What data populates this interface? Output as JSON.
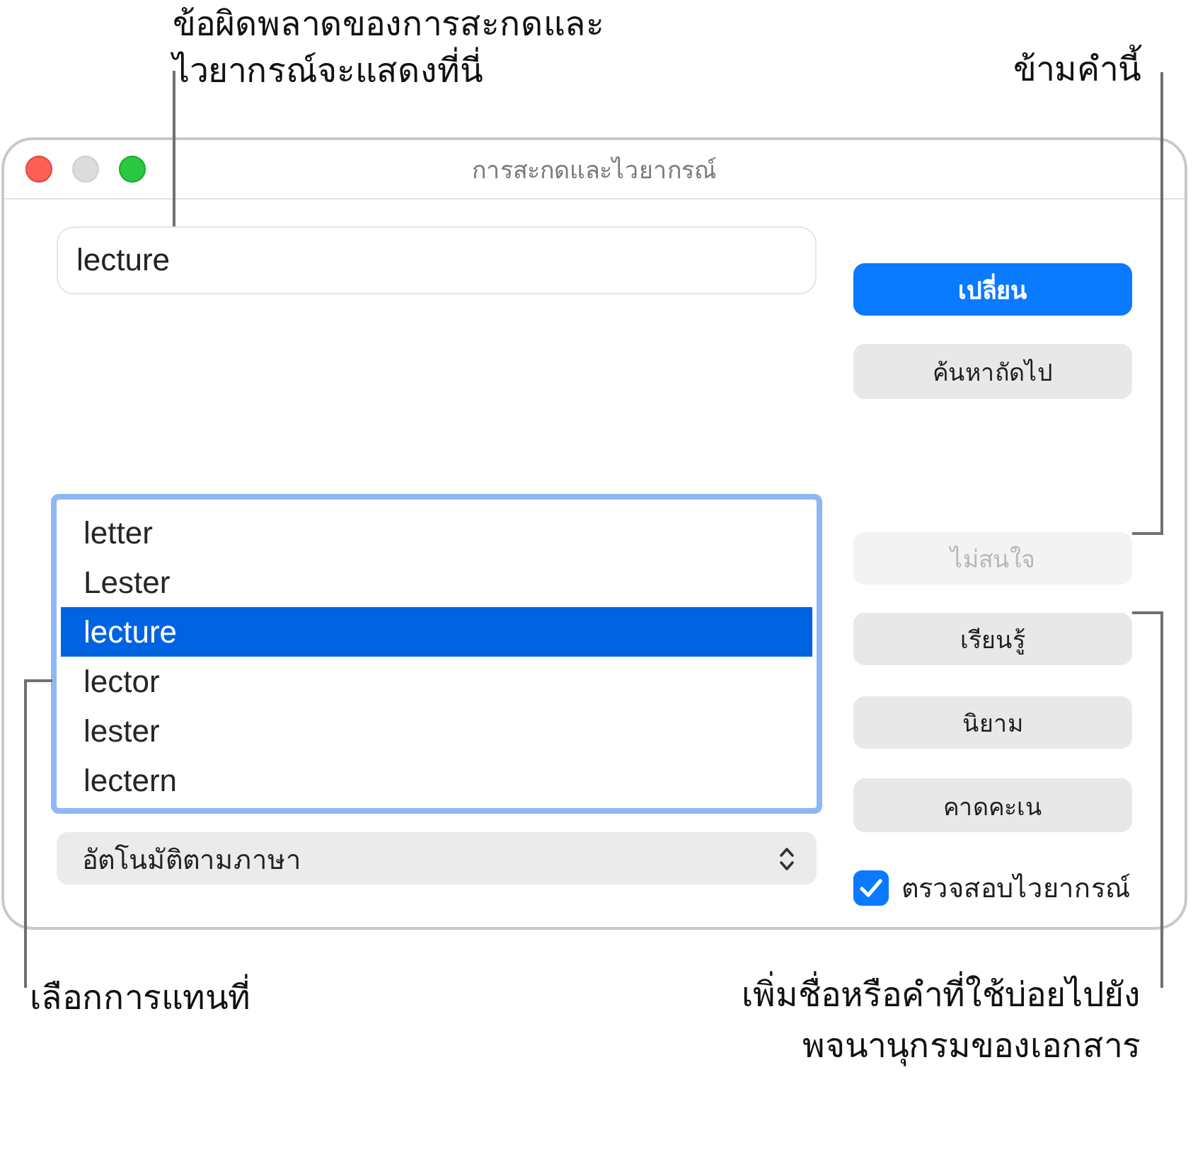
{
  "callouts": [
    {
      "lines": [
        "ข้อผิดพลาดของการสะกดและ",
        "ไวยากรณ์จะแสดงที่นี่"
      ]
    },
    {
      "lines": [
        "ข้ามคำนี้"
      ]
    },
    {
      "lines": [
        "เลือกการแทนที่"
      ]
    },
    {
      "lines": [
        "เพิ่มชื่อหรือคำที่ใช้บ่อยไปยัง",
        "พจนานุกรมของเอกสาร"
      ]
    }
  ],
  "window": {
    "window_controls": [
      {
        "kind": "close",
        "disabled": false
      },
      {
        "kind": "minimize",
        "disabled": true
      },
      {
        "kind": "zoom",
        "disabled": false
      }
    ],
    "title": "การสะกดและไวยากรณ์",
    "word_field": {
      "value": "lecture"
    },
    "action_buttons": [
      {
        "label": "เปลี่ยน",
        "kind": "default",
        "disabled": false
      },
      {
        "label": "ค้นหาถัดไป",
        "kind": "push",
        "disabled": false
      }
    ],
    "suggestions": [
      {
        "label": "letter",
        "selected": false
      },
      {
        "label": "Lester",
        "selected": false
      },
      {
        "label": "lecture",
        "selected": true
      },
      {
        "label": "lector",
        "selected": false
      },
      {
        "label": "lester",
        "selected": false
      },
      {
        "label": "lectern",
        "selected": false
      }
    ],
    "word_buttons": [
      {
        "label": "ไม่สนใจ",
        "kind": "push",
        "disabled": true
      },
      {
        "label": "เรียนรู้",
        "kind": "push",
        "disabled": false
      },
      {
        "label": "นิยาม",
        "kind": "push",
        "disabled": false
      },
      {
        "label": "คาดคะเน",
        "kind": "push",
        "disabled": false
      }
    ],
    "language_menu": {
      "value": "อัตโนมัติตามภาษา"
    },
    "grammar_check": {
      "label": "ตรวจสอบไวยากรณ์",
      "checked": true
    }
  }
}
